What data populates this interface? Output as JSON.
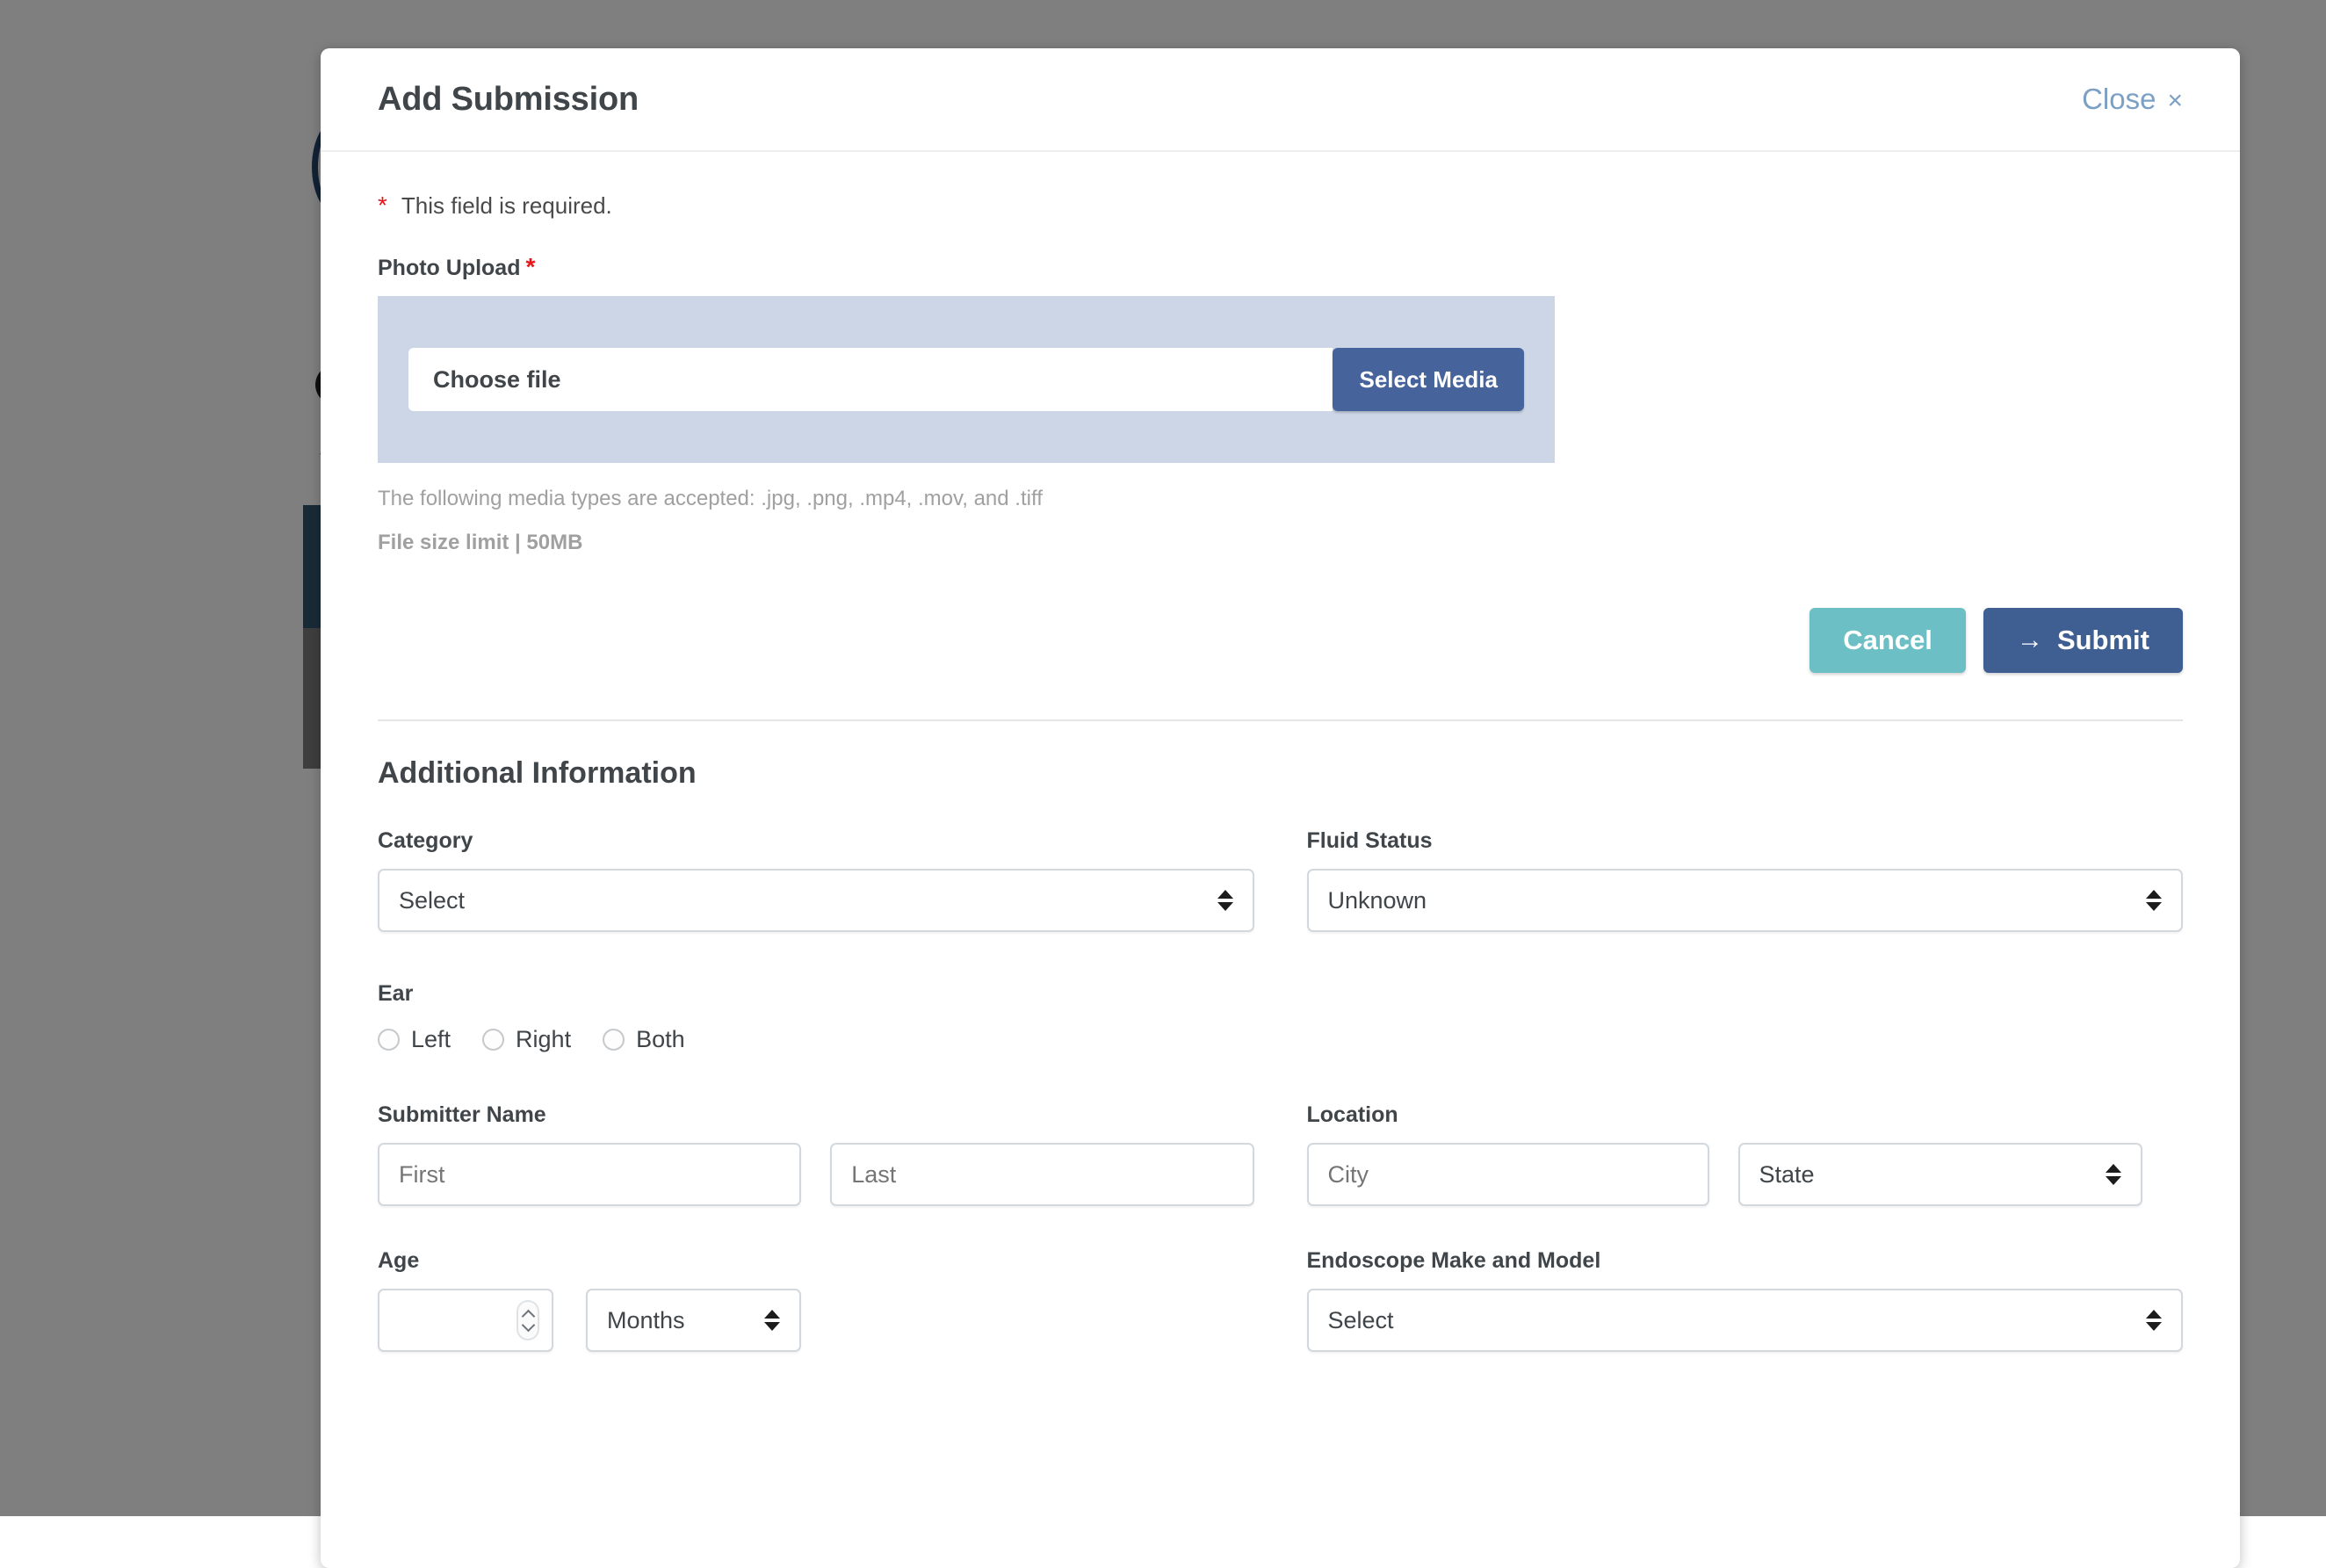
{
  "modal": {
    "title": "Add Submission",
    "close_label": "Close",
    "close_x": "×",
    "required_note": "This field is required.",
    "required_star": "*"
  },
  "upload": {
    "label": "Photo Upload",
    "required_star": "*",
    "choose_file_text": "Choose file",
    "select_media_label": "Select Media",
    "accepted_types_text": "The following media types are accepted: .jpg, .png, .mp4, .mov, and .tiff",
    "file_size_limit_text": "File size limit | 50MB"
  },
  "actions": {
    "cancel_label": "Cancel",
    "submit_label": "Submit",
    "submit_arrow": "→"
  },
  "additional": {
    "section_title": "Additional Information",
    "category": {
      "label": "Category",
      "value": "Select"
    },
    "fluid_status": {
      "label": "Fluid Status",
      "value": "Unknown"
    },
    "ear": {
      "label": "Ear",
      "options": [
        {
          "label": "Left",
          "selected": false
        },
        {
          "label": "Right",
          "selected": false
        },
        {
          "label": "Both",
          "selected": false
        }
      ]
    },
    "submitter_name": {
      "label": "Submitter Name",
      "first_placeholder": "First",
      "first_value": "",
      "last_placeholder": "Last",
      "last_value": ""
    },
    "location": {
      "label": "Location",
      "city_placeholder": "City",
      "city_value": "",
      "state_value": "State"
    },
    "age": {
      "label": "Age",
      "value": "",
      "unit_value": "Months"
    },
    "endoscope": {
      "label": "Endoscope Make and Model",
      "value": "Select"
    }
  },
  "colors": {
    "accent_blue": "#46639c",
    "submit_blue": "#3f5e91",
    "cancel_teal": "#6cbfc4",
    "upload_panel": "#ccd6e6",
    "required_red": "#e8161b",
    "close_link": "#7ca0c4",
    "overlay": "rgba(0,0,0,0.5)"
  }
}
